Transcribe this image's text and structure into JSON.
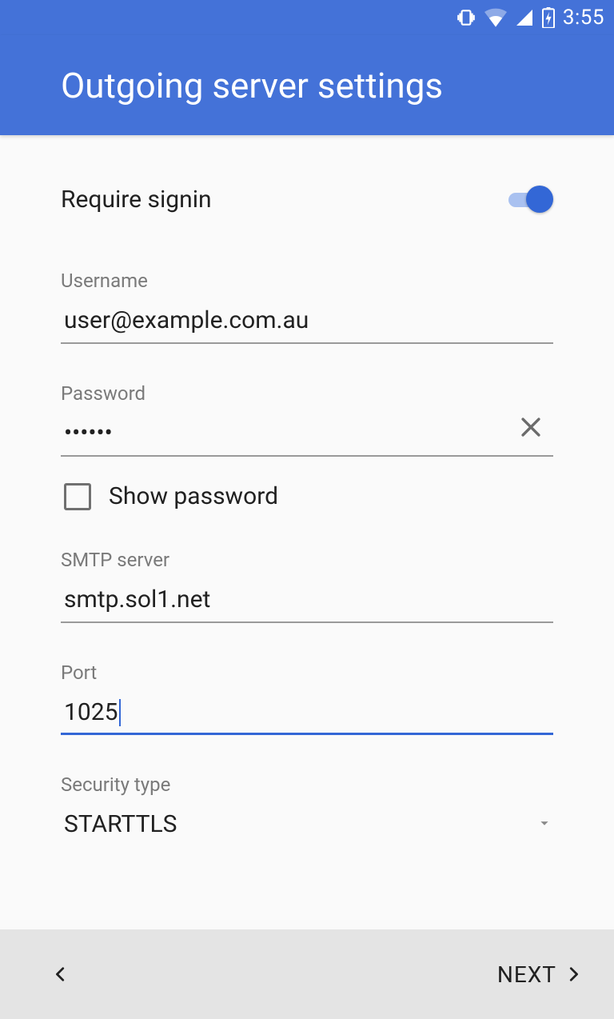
{
  "statusbar": {
    "time": "3:55"
  },
  "appbar": {
    "title": "Outgoing server settings"
  },
  "toggle": {
    "label": "Require signin",
    "on": true
  },
  "username": {
    "label": "Username",
    "value": "user@example.com.au"
  },
  "password": {
    "label": "Password",
    "value": "••••••",
    "show_label": "Show password",
    "show_checked": false
  },
  "smtp": {
    "label": "SMTP server",
    "value": "smtp.sol1.net"
  },
  "port": {
    "label": "Port",
    "value": "1025",
    "focused": true
  },
  "security": {
    "label": "Security type",
    "value": "STARTTLS"
  },
  "bottom": {
    "next": "NEXT"
  }
}
